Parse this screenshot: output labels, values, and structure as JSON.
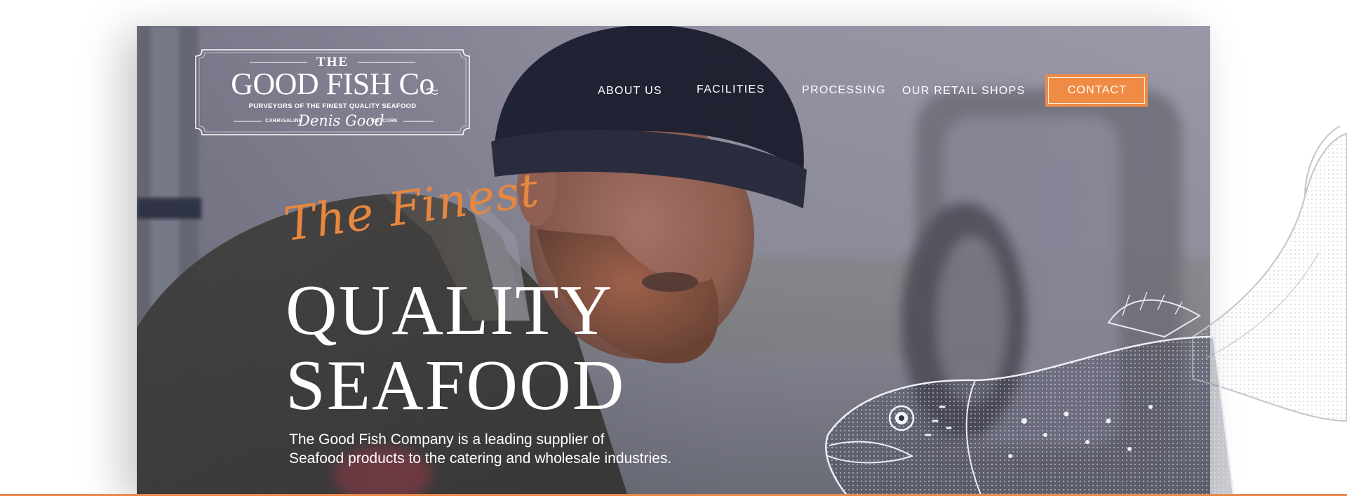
{
  "logo": {
    "the": "THE",
    "name": "GOOD FISH Co",
    "tagline": "PURVEYORS OF THE FINEST QUALITY SEAFOOD",
    "location_left": "CARRIGALINE",
    "signature": "Denis Good",
    "location_right": "CO. CORK"
  },
  "nav": {
    "items": [
      {
        "label": "ABOUT US"
      },
      {
        "label": "FACILITIES"
      },
      {
        "label": "PROCESSING"
      },
      {
        "label": "OUR RETAIL SHOPS"
      }
    ],
    "cta": "CONTACT"
  },
  "hero": {
    "script": "The Finest",
    "title_line1": "QUALITY",
    "title_line2": "SEAFOOD",
    "desc_line1": "The Good Fish Company is a leading supplier of",
    "desc_line2": "Seafood products to the catering and wholesale industries."
  },
  "colors": {
    "accent": "#f08b45",
    "script": "#e8873e",
    "text": "#ffffff"
  }
}
